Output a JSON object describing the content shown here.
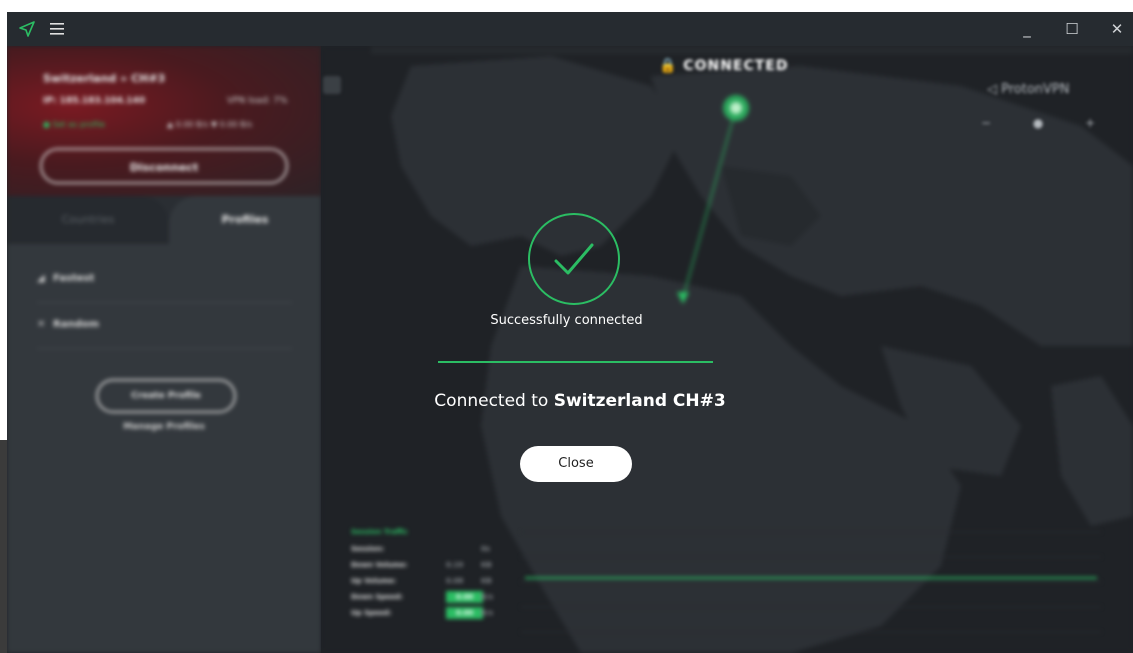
{
  "titlebar": {
    "menu_icon": "hamburger-icon",
    "logo_icon": "proton-triangle-icon",
    "minimize": "_",
    "maximize": "☐",
    "close": "✕"
  },
  "sidebar": {
    "server_title": "Switzerland » CH#3",
    "ip": "IP: 185.183.104.140",
    "vpn_load": "VPN load: 7%",
    "favorite": "● Set as profile",
    "traffic": "▲ 0.00 B/s  ▼ 0.00 B/s",
    "disconnect": "Disconnect",
    "tabs": {
      "countries": "Countries",
      "profiles": "Profiles"
    },
    "profiles": [
      {
        "icon": "◢",
        "label": "Fastest"
      },
      {
        "icon": "✕",
        "label": "Random"
      }
    ],
    "create_profile": "Create Profile",
    "manage_profiles": "Manage Profiles"
  },
  "map": {
    "status": "🔒 CONNECTED",
    "brand": "◁ ProtonVPN",
    "zoom": "− ● +"
  },
  "traffic_panel": {
    "title": "Session Traffic",
    "rows": [
      {
        "label": "Session:",
        "value": "",
        "unit": "0s",
        "highlight": false
      },
      {
        "label": "Down Volume:",
        "value": "0.19",
        "unit": "KB",
        "highlight": false
      },
      {
        "label": "Up Volume:",
        "value": "0.08",
        "unit": "KB",
        "highlight": false
      },
      {
        "label": "Down Speed:",
        "value": "0.00",
        "unit": "B/s",
        "highlight": true
      },
      {
        "label": "Up Speed:",
        "value": "0.00",
        "unit": "B/s",
        "highlight": true
      }
    ]
  },
  "dialog": {
    "success": "Successfully connected",
    "connected_prefix": "Connected to ",
    "server": "Switzerland CH#3",
    "close": "Close"
  },
  "colors": {
    "accent": "#2bbd63",
    "sidebar_bg": "#33383d",
    "map_bg": "#1f2226"
  }
}
